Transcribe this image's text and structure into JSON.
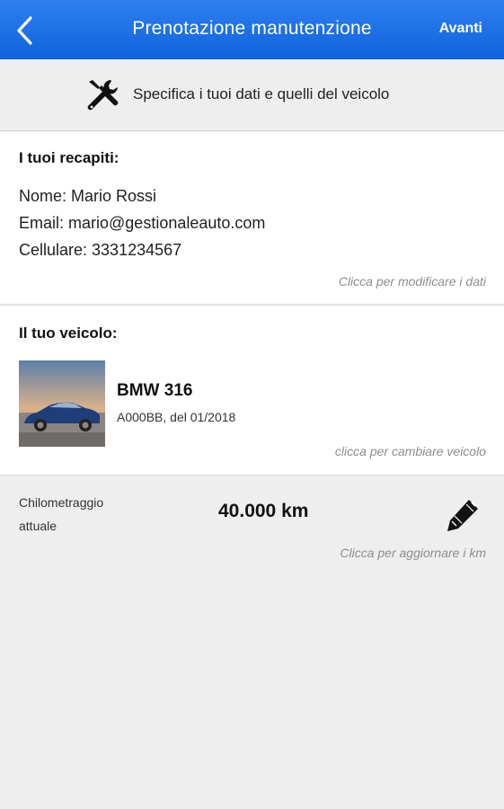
{
  "header": {
    "title": "Prenotazione manutenzione",
    "next_label": "Avanti",
    "back_icon": "chevron-left-icon",
    "color": "#1a6fe6"
  },
  "instruction": {
    "icon": "tools-icon",
    "text": "Specifica i tuoi dati e quelli del veicolo"
  },
  "contacts": {
    "title": "I tuoi recapiti:",
    "name_line": "Nome: Mario Rossi",
    "email_line": "Email: mario@gestionaleauto.com",
    "phone_line": "Cellulare: 3331234567",
    "hint": "Clicca per modificare i dati"
  },
  "vehicle": {
    "title": "Il tuo veicolo:",
    "name": "BMW 316",
    "plate_date": "A000BB, del 01/2018",
    "hint": "clicca per cambiare veicolo"
  },
  "mileage": {
    "label": "Chilometraggio attuale",
    "value": "40.000 km",
    "hint": "Clicca per aggiornare i km",
    "icon": "pencil-icon"
  }
}
